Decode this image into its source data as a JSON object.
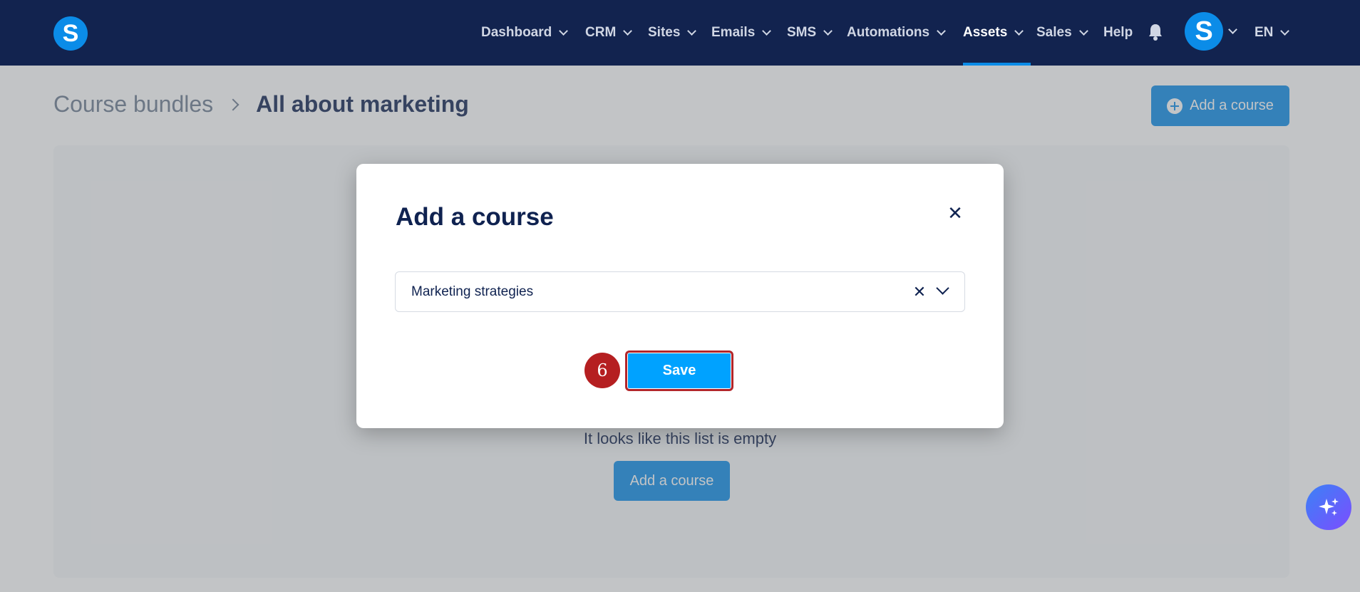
{
  "nav": {
    "items": [
      {
        "label": "Dashboard",
        "dropdown": true
      },
      {
        "label": "CRM",
        "dropdown": true
      },
      {
        "label": "Sites",
        "dropdown": true
      },
      {
        "label": "Emails",
        "dropdown": true
      },
      {
        "label": "SMS",
        "dropdown": true
      },
      {
        "label": "Automations",
        "dropdown": true
      },
      {
        "label": "Assets",
        "dropdown": true,
        "active": true
      },
      {
        "label": "Sales",
        "dropdown": true
      },
      {
        "label": "Help",
        "dropdown": false
      }
    ],
    "logo_letter": "S",
    "avatar_letter": "S",
    "language": "EN",
    "accent_color": "#0b8ce8",
    "bar_color": "#12234f"
  },
  "breadcrumb": {
    "parent": "Course bundles",
    "current": "All about marketing"
  },
  "header": {
    "add_course_label": "Add a course"
  },
  "content": {
    "empty_message": "It looks like this list is empty",
    "add_course_label": "Add a course"
  },
  "modal": {
    "title": "Add a course",
    "select_value": "Marketing strategies",
    "save_label": "Save",
    "step_number": "6",
    "highlight_color": "#b3262a"
  },
  "icons": {
    "bell": "bell-icon",
    "close": "close-icon",
    "clear": "clear-icon",
    "chevron": "chevron-down-icon",
    "assistant": "sparkles-icon"
  }
}
